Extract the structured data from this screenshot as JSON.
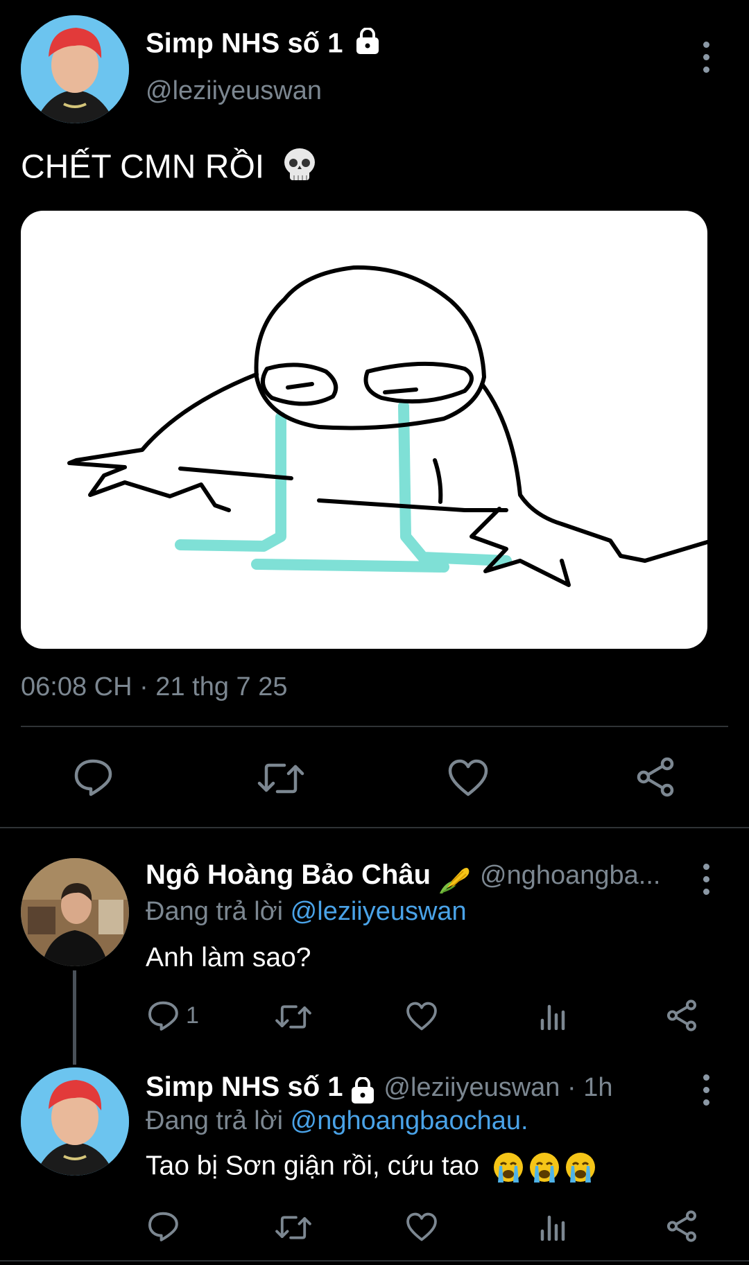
{
  "main_tweet": {
    "display_name": "Simp NHS số 1",
    "handle": "@leziiyeuswan",
    "text": "CHẾT CMN RỒI",
    "emoji": "skull-emoji",
    "timestamp": "06:08 CH · 21 thg 7 25",
    "actions": [
      "reply-icon",
      "retweet-icon",
      "like-icon",
      "share-icon"
    ]
  },
  "replies": [
    {
      "display_name": "Ngô Hoàng Bảo Châu",
      "name_emoji": "corn-emoji",
      "handle": "@nghoangba...",
      "replying_prefix": "Đang trả lời",
      "replying_to": "@leziiyeuswan",
      "text": "Anh làm sao?",
      "reply_count": "1"
    },
    {
      "display_name": "Simp NHS số 1",
      "handle_time": "@leziiyeuswan · 1h",
      "replying_prefix": "Đang trả lời",
      "replying_to": "@nghoangbaochau.",
      "text": "Tao bị Sơn giận rồi, cứu tao",
      "emoji": "crying-emoji x3"
    }
  ],
  "colors": {
    "background": "#000000",
    "text": "#ffffff",
    "muted": "#7c8791",
    "link": "#4aa3e8",
    "divider": "#2f3336",
    "tears": "#7fe0d6"
  }
}
